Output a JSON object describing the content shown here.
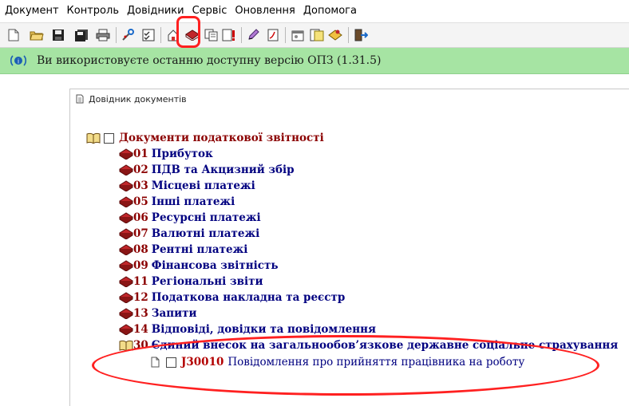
{
  "menu": [
    "Документ",
    "Контроль",
    "Довідники",
    "Сервіс",
    "Оновлення",
    "Допомога"
  ],
  "toolbar_icons": [
    "new-document-icon",
    "open-folder-icon",
    "save-icon",
    "save-all-icon",
    "print-icon",
    "tools-icon",
    "checklist-icon",
    "home-icon",
    "book-icon",
    "copy-icon",
    "alert-doc-icon",
    "edit-pencil-icon",
    "pdf-icon",
    "settings-icon",
    "notes-icon",
    "archive-icon",
    "exit-icon"
  ],
  "notice": {
    "icon": "info-wave-icon",
    "text": "Ви використовуєте останню доступну версію ОПЗ (1.31.5)",
    "bg_color": "#a6e4a3"
  },
  "window": {
    "title": "Довідник документів"
  },
  "tree": {
    "root_label": "Документи податкової звітності",
    "items": [
      {
        "code": "01",
        "name": "Прибуток"
      },
      {
        "code": "02",
        "name": "ПДВ та Акцизний збір"
      },
      {
        "code": "03",
        "name": "Місцеві платежі"
      },
      {
        "code": "05",
        "name": "Інші платежі"
      },
      {
        "code": "06",
        "name": "Ресурсні платежі"
      },
      {
        "code": "07",
        "name": "Валютні платежі"
      },
      {
        "code": "08",
        "name": "Рентні платежі"
      },
      {
        "code": "09",
        "name": "Фінансова звітність"
      },
      {
        "code": "11",
        "name": "Регіональні звіти"
      },
      {
        "code": "12",
        "name": "Податкова накладна та реєстр"
      },
      {
        "code": "13",
        "name": "Запити"
      },
      {
        "code": "14",
        "name": "Відповіді, довідки та повідомлення"
      },
      {
        "code": "30",
        "name": "Єдиний внесок на загальнообов’язкове державне соціальне страхування"
      }
    ],
    "doc": {
      "code": "J30010",
      "name": "Повідомлення про прийняття працівника на роботу"
    }
  },
  "colors": {
    "code_red": "#8b0000",
    "name_navy": "#000080",
    "annotation_red": "#ff2020"
  }
}
